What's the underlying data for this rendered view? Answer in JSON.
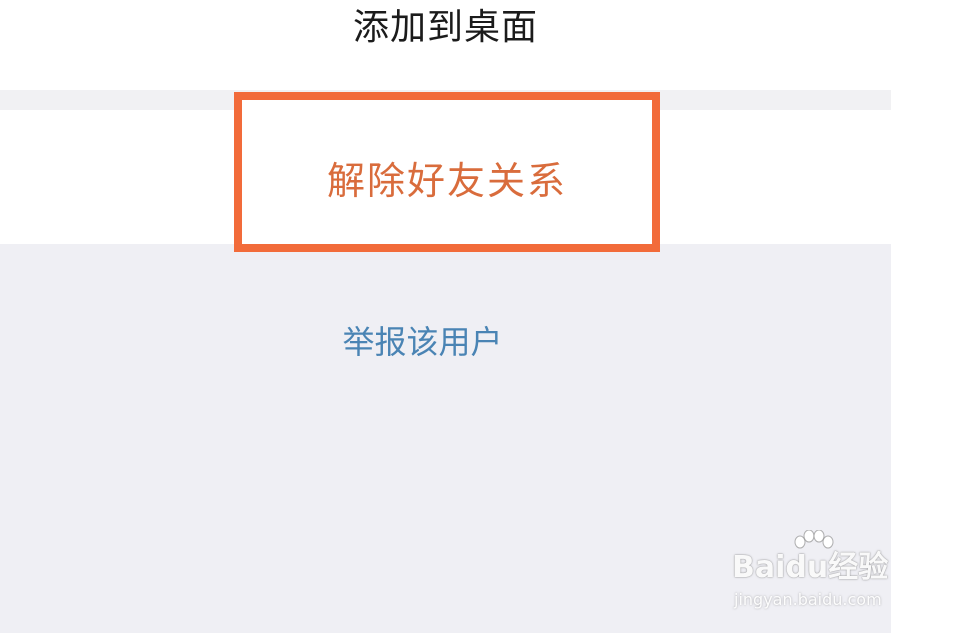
{
  "menu": {
    "add_to_desktop": "添加到桌面",
    "remove_friend": "解除好友关系"
  },
  "footer": {
    "report_user": "举报该用户"
  },
  "watermark": {
    "brand": "Baidu经验",
    "url": "jingyan.baidu.com",
    "icon": "paw-icon"
  },
  "colors": {
    "highlight_border": "#f26b3a",
    "danger_text": "#d96c3c",
    "link_text": "#4a84b4",
    "background_gray": "#efeff4"
  }
}
